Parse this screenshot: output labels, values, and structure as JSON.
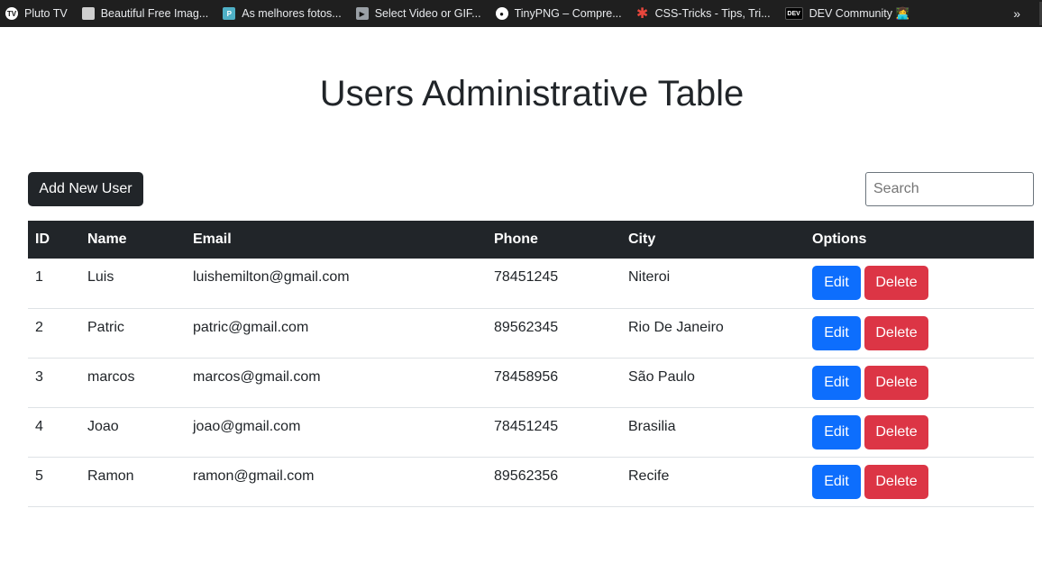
{
  "bookmarks": {
    "items": [
      {
        "label": "Pluto TV",
        "icon": "pluto-tv-icon",
        "color": "#ffffff"
      },
      {
        "label": "Beautiful Free Imag...",
        "icon": "unsplash-icon",
        "color": "#cfcfcf"
      },
      {
        "label": "As melhores fotos...",
        "icon": "pexels-icon",
        "color": "#4fb0c6"
      },
      {
        "label": "Select Video or GIF...",
        "icon": "video-icon",
        "color": "#9aa0a6"
      },
      {
        "label": "TinyPNG – Compre...",
        "icon": "panda-icon",
        "color": "#ffffff"
      },
      {
        "label": "CSS-Tricks - Tips, Tri...",
        "icon": "asterisk-icon",
        "color": "#e8463c"
      },
      {
        "label": "DEV Community 👩‍💻",
        "icon": "dev-icon",
        "color": "#ffffff"
      }
    ],
    "more_label": "»"
  },
  "page": {
    "title": "Users Administrative Table"
  },
  "toolbar": {
    "add_label": "Add New User",
    "search_placeholder": "Search"
  },
  "table": {
    "columns": [
      "ID",
      "Name",
      "Email",
      "Phone",
      "City",
      "Options"
    ],
    "rows": [
      {
        "id": "1",
        "name": "Luis",
        "email": "luishemilton@gmail.com",
        "phone": "78451245",
        "city": "Niteroi"
      },
      {
        "id": "2",
        "name": "Patric",
        "email": "patric@gmail.com",
        "phone": "89562345",
        "city": "Rio De Janeiro"
      },
      {
        "id": "3",
        "name": "marcos",
        "email": "marcos@gmail.com",
        "phone": "78458956",
        "city": "São Paulo"
      },
      {
        "id": "4",
        "name": "Joao",
        "email": "joao@gmail.com",
        "phone": "78451245",
        "city": "Brasilia"
      },
      {
        "id": "5",
        "name": "Ramon",
        "email": "ramon@gmail.com",
        "phone": "89562356",
        "city": "Recife"
      }
    ],
    "edit_label": "Edit",
    "delete_label": "Delete"
  },
  "colors": {
    "dark": "#212529",
    "primary": "#0d6efd",
    "danger": "#dc3545"
  }
}
